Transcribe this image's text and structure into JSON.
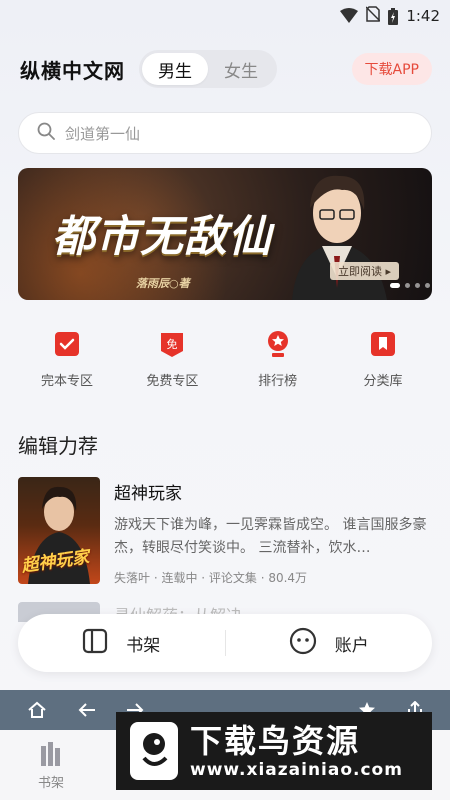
{
  "status_bar": {
    "time": "1:42"
  },
  "header": {
    "app_title": "纵横中文网",
    "gender_tabs": [
      {
        "label": "男生",
        "active": true
      },
      {
        "label": "女生",
        "active": false
      }
    ],
    "download_label": "下载APP"
  },
  "search": {
    "placeholder": "剑道第一仙"
  },
  "banner": {
    "title": "都市无敌仙",
    "author": "落雨辰○著",
    "read_label": "立即阅读 ▸",
    "page_count": 4,
    "active_page": 1
  },
  "quick_nav": [
    {
      "label": "完本专区",
      "icon": "check-badge-icon"
    },
    {
      "label": "免费专区",
      "icon": "free-tag-icon"
    },
    {
      "label": "排行榜",
      "icon": "trophy-icon"
    },
    {
      "label": "分类库",
      "icon": "bookmark-icon"
    }
  ],
  "section": {
    "title": "编辑力荐",
    "book": {
      "title": "超神玩家",
      "desc": "游戏天下谁为峰，一见霁霖皆成空。 谁言国服多豪杰，转眼尽付笑谈中。 三流替补，饮水…",
      "meta": "失落叶 · 连载中 · 评论文集 · 80.4万",
      "cover_text": "超神玩家"
    },
    "next_title": "寻仙解药：从解决…"
  },
  "float_bar": {
    "shelf_label": "书架",
    "account_label": "账户"
  },
  "bottom_nav": {
    "shelf_label": "书架"
  },
  "watermark": {
    "title": "下载鸟资源",
    "url": "www.xiazainiao.com"
  },
  "colors": {
    "accent_red": "#e64a3b",
    "browser_bar": "#5e6f80"
  }
}
